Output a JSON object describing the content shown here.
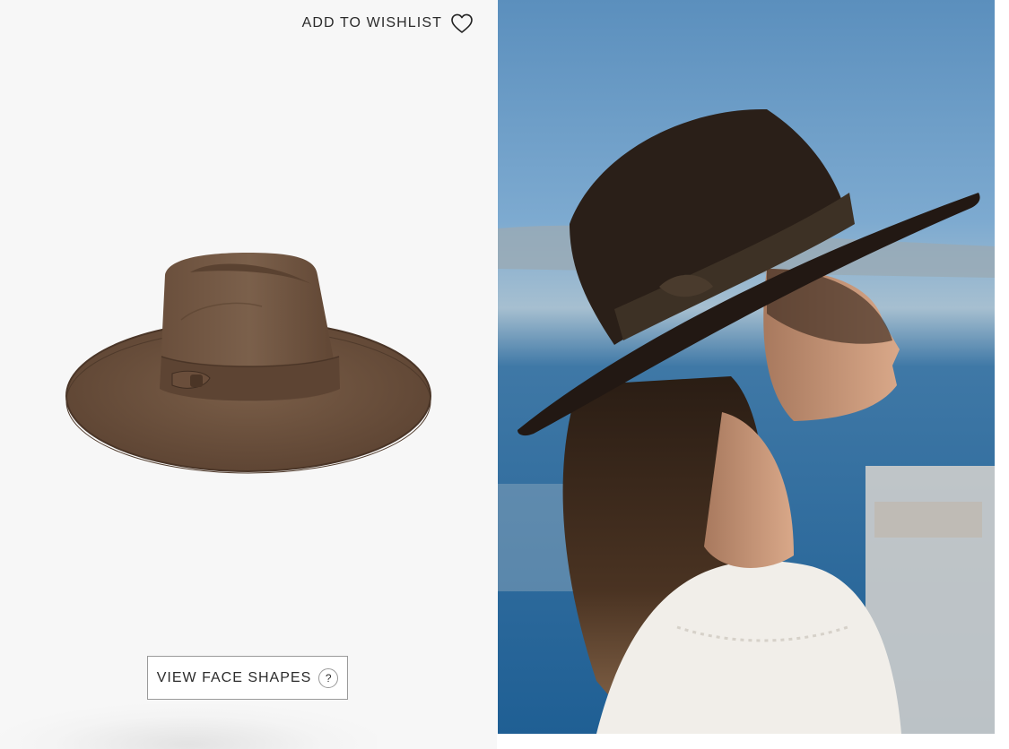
{
  "wishlist": {
    "label": "ADD TO WISHLIST",
    "icon": "heart-outline-icon"
  },
  "product": {
    "image_description": "brown felt fedora hat with ribbon band",
    "hat_color": "#6e5440"
  },
  "face_shapes": {
    "label": "VIEW FACE SHAPES",
    "help_glyph": "?"
  },
  "lifestyle": {
    "image_description": "woman in profile wearing a dark brown wide-brim fedora by the sea"
  },
  "colors": {
    "panel_background": "#f7f7f7",
    "text": "#2b2b2b",
    "border": "#9a9a9a",
    "sky": "#6f9ec6",
    "sea": "#2c6ea4"
  }
}
